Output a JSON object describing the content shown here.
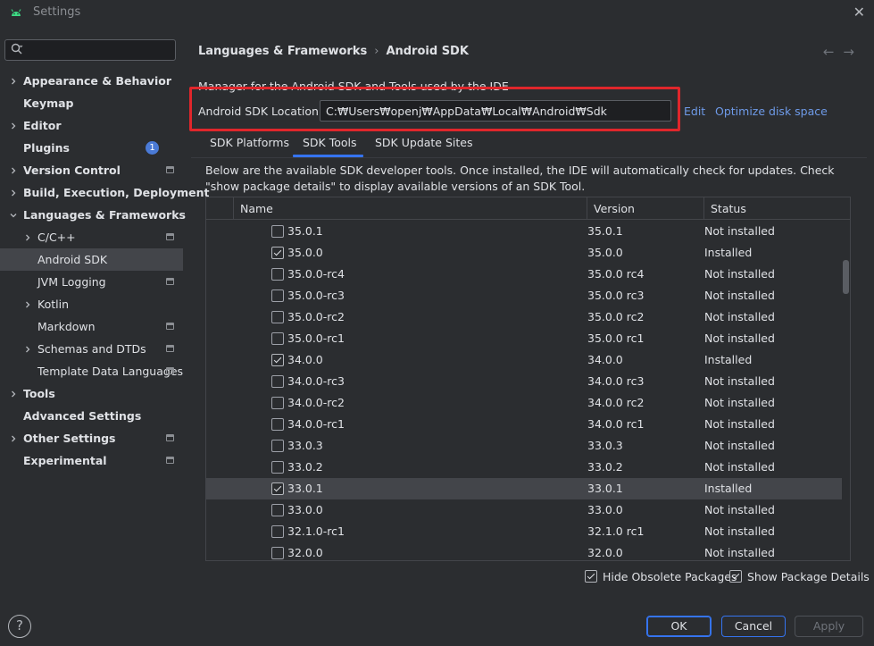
{
  "window": {
    "title": "Settings",
    "close_glyph": "✕"
  },
  "search": {
    "placeholder": "",
    "value": ""
  },
  "sidebar": {
    "items": [
      {
        "label": "Appearance & Behavior",
        "expandable": true,
        "bold": true
      },
      {
        "label": "Keymap",
        "expandable": false,
        "bold": true
      },
      {
        "label": "Editor",
        "expandable": true,
        "bold": true
      },
      {
        "label": "Plugins",
        "expandable": false,
        "bold": true,
        "badge": "1"
      },
      {
        "label": "Version Control",
        "expandable": true,
        "bold": true,
        "project_icon": true
      },
      {
        "label": "Build, Execution, Deployment",
        "expandable": true,
        "bold": true
      },
      {
        "label": "Languages & Frameworks",
        "expandable": true,
        "expanded": true,
        "bold": true
      },
      {
        "label": "C/C++",
        "expandable": true,
        "sub": true,
        "project_icon": true
      },
      {
        "label": "Android SDK",
        "sub": true,
        "selected": true
      },
      {
        "label": "JVM Logging",
        "sub": true,
        "project_icon": true
      },
      {
        "label": "Kotlin",
        "expandable": true,
        "sub": true
      },
      {
        "label": "Markdown",
        "sub": true,
        "project_icon": true
      },
      {
        "label": "Schemas and DTDs",
        "expandable": true,
        "sub": true,
        "project_icon": true
      },
      {
        "label": "Template Data Languages",
        "sub": true,
        "project_icon": true
      },
      {
        "label": "Tools",
        "expandable": true,
        "bold": true
      },
      {
        "label": "Advanced Settings",
        "bold": true
      },
      {
        "label": "Other Settings",
        "expandable": true,
        "bold": true,
        "project_icon": true
      },
      {
        "label": "Experimental",
        "bold": true,
        "project_icon": true
      }
    ],
    "help_glyph": "?"
  },
  "breadcrumb": {
    "parent": "Languages & Frameworks",
    "separator": "›",
    "current": "Android SDK"
  },
  "nav": {
    "back": "←",
    "forward": "→"
  },
  "description": "Manager for the Android SDK and Tools used by the IDE",
  "sdk_location": {
    "label": "Android SDK Location:",
    "value": "C:₩Users₩openj₩AppData₩Local₩Android₩Sdk",
    "edit_link": "Edit",
    "optimize_link": "Optimize disk space"
  },
  "tabs": [
    {
      "label": "SDK Platforms"
    },
    {
      "label": "SDK Tools",
      "active": true
    },
    {
      "label": "SDK Update Sites"
    }
  ],
  "info_text": "Below are the available SDK developer tools. Once installed, the IDE will automatically check for updates. Check \"show package details\" to display available versions of an SDK Tool.",
  "table": {
    "columns": [
      "Name",
      "Version",
      "Status"
    ],
    "rows": [
      {
        "name": "35.0.1",
        "version": "35.0.1",
        "status": "Not installed",
        "checked": false
      },
      {
        "name": "35.0.0",
        "version": "35.0.0",
        "status": "Installed",
        "checked": true
      },
      {
        "name": "35.0.0-rc4",
        "version": "35.0.0 rc4",
        "status": "Not installed",
        "checked": false
      },
      {
        "name": "35.0.0-rc3",
        "version": "35.0.0 rc3",
        "status": "Not installed",
        "checked": false
      },
      {
        "name": "35.0.0-rc2",
        "version": "35.0.0 rc2",
        "status": "Not installed",
        "checked": false
      },
      {
        "name": "35.0.0-rc1",
        "version": "35.0.0 rc1",
        "status": "Not installed",
        "checked": false
      },
      {
        "name": "34.0.0",
        "version": "34.0.0",
        "status": "Installed",
        "checked": true
      },
      {
        "name": "34.0.0-rc3",
        "version": "34.0.0 rc3",
        "status": "Not installed",
        "checked": false
      },
      {
        "name": "34.0.0-rc2",
        "version": "34.0.0 rc2",
        "status": "Not installed",
        "checked": false
      },
      {
        "name": "34.0.0-rc1",
        "version": "34.0.0 rc1",
        "status": "Not installed",
        "checked": false
      },
      {
        "name": "33.0.3",
        "version": "33.0.3",
        "status": "Not installed",
        "checked": false
      },
      {
        "name": "33.0.2",
        "version": "33.0.2",
        "status": "Not installed",
        "checked": false
      },
      {
        "name": "33.0.1",
        "version": "33.0.1",
        "status": "Installed",
        "checked": true,
        "selected": true
      },
      {
        "name": "33.0.0",
        "version": "33.0.0",
        "status": "Not installed",
        "checked": false
      },
      {
        "name": "32.1.0-rc1",
        "version": "32.1.0 rc1",
        "status": "Not installed",
        "checked": false
      },
      {
        "name": "32.0.0",
        "version": "32.0.0",
        "status": "Not installed",
        "checked": false
      }
    ]
  },
  "options": {
    "hide_obsolete": {
      "label": "Hide Obsolete Packages",
      "checked": true
    },
    "show_details": {
      "label": "Show Package Details",
      "checked": true
    }
  },
  "buttons": {
    "ok": "OK",
    "cancel": "Cancel",
    "apply": "Apply"
  },
  "colors": {
    "accent": "#3574f0",
    "highlight_box": "#e0262b",
    "link": "#6e9ae8",
    "badge": "#4a7ad6"
  }
}
